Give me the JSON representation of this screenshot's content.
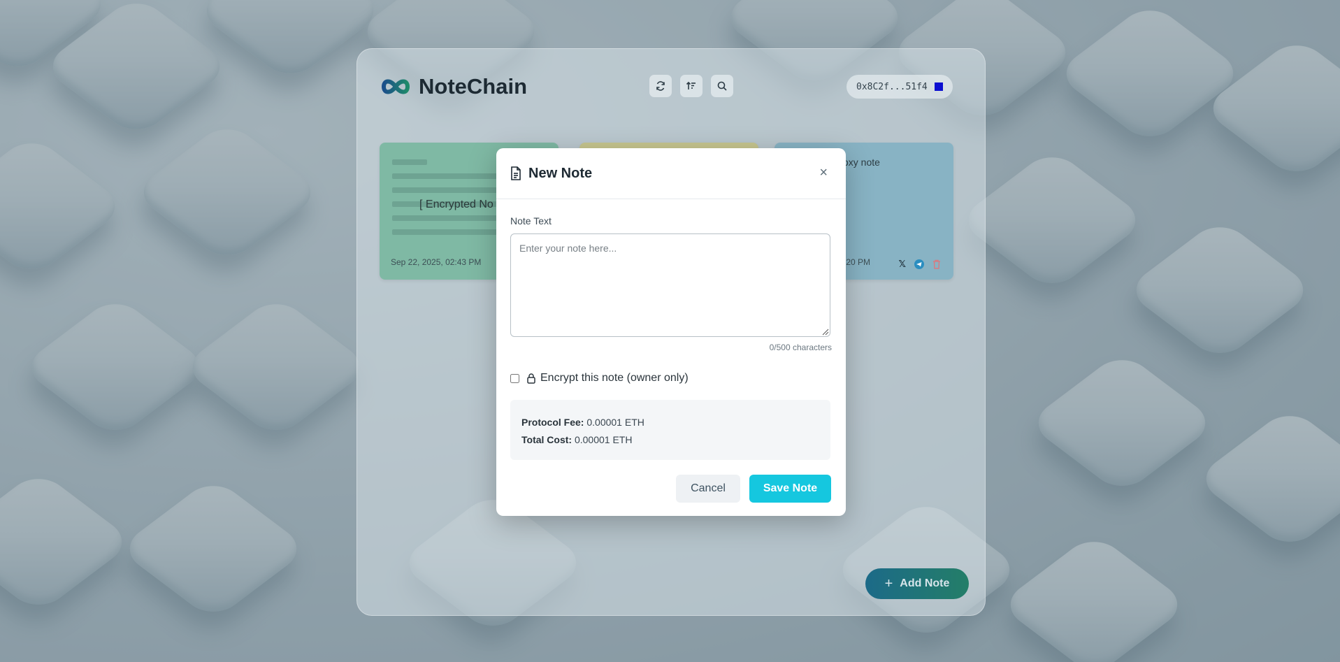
{
  "app": {
    "name": "NoteChain"
  },
  "wallet": {
    "address": "0x8C2f...51f4",
    "color": "#0c0fd0"
  },
  "toolbar": {
    "icons": [
      "refresh-icon",
      "sort-icon",
      "search-icon"
    ]
  },
  "notes": [
    {
      "type": "encrypted",
      "label": "[ Encrypted No",
      "date": "Sep 22, 2025, 02:43 PM",
      "color": "#7fb9a4"
    },
    {
      "type": "plain",
      "color": "#c7c68f"
    },
    {
      "type": "plain",
      "text": "oxy note",
      "date": ":20 PM",
      "color": "#88b3c4",
      "actions": [
        "x-share-icon",
        "telegram-share-icon",
        "delete-icon"
      ]
    }
  ],
  "add_note": {
    "label": "Add Note"
  },
  "modal": {
    "title": "New Note",
    "close_label": "×",
    "field_label": "Note Text",
    "placeholder": "Enter your note here...",
    "value": "",
    "char_count": "0/500 characters",
    "encrypt_label": "Encrypt this note (owner only)",
    "encrypt_checked": false,
    "fee": {
      "protocol_fee_label": "Protocol Fee:",
      "protocol_fee_value": "0.00001 ETH",
      "total_cost_label": "Total Cost:",
      "total_cost_value": "0.00001 ETH"
    },
    "cancel_label": "Cancel",
    "save_label": "Save Note",
    "save_color": "#15c7df"
  }
}
